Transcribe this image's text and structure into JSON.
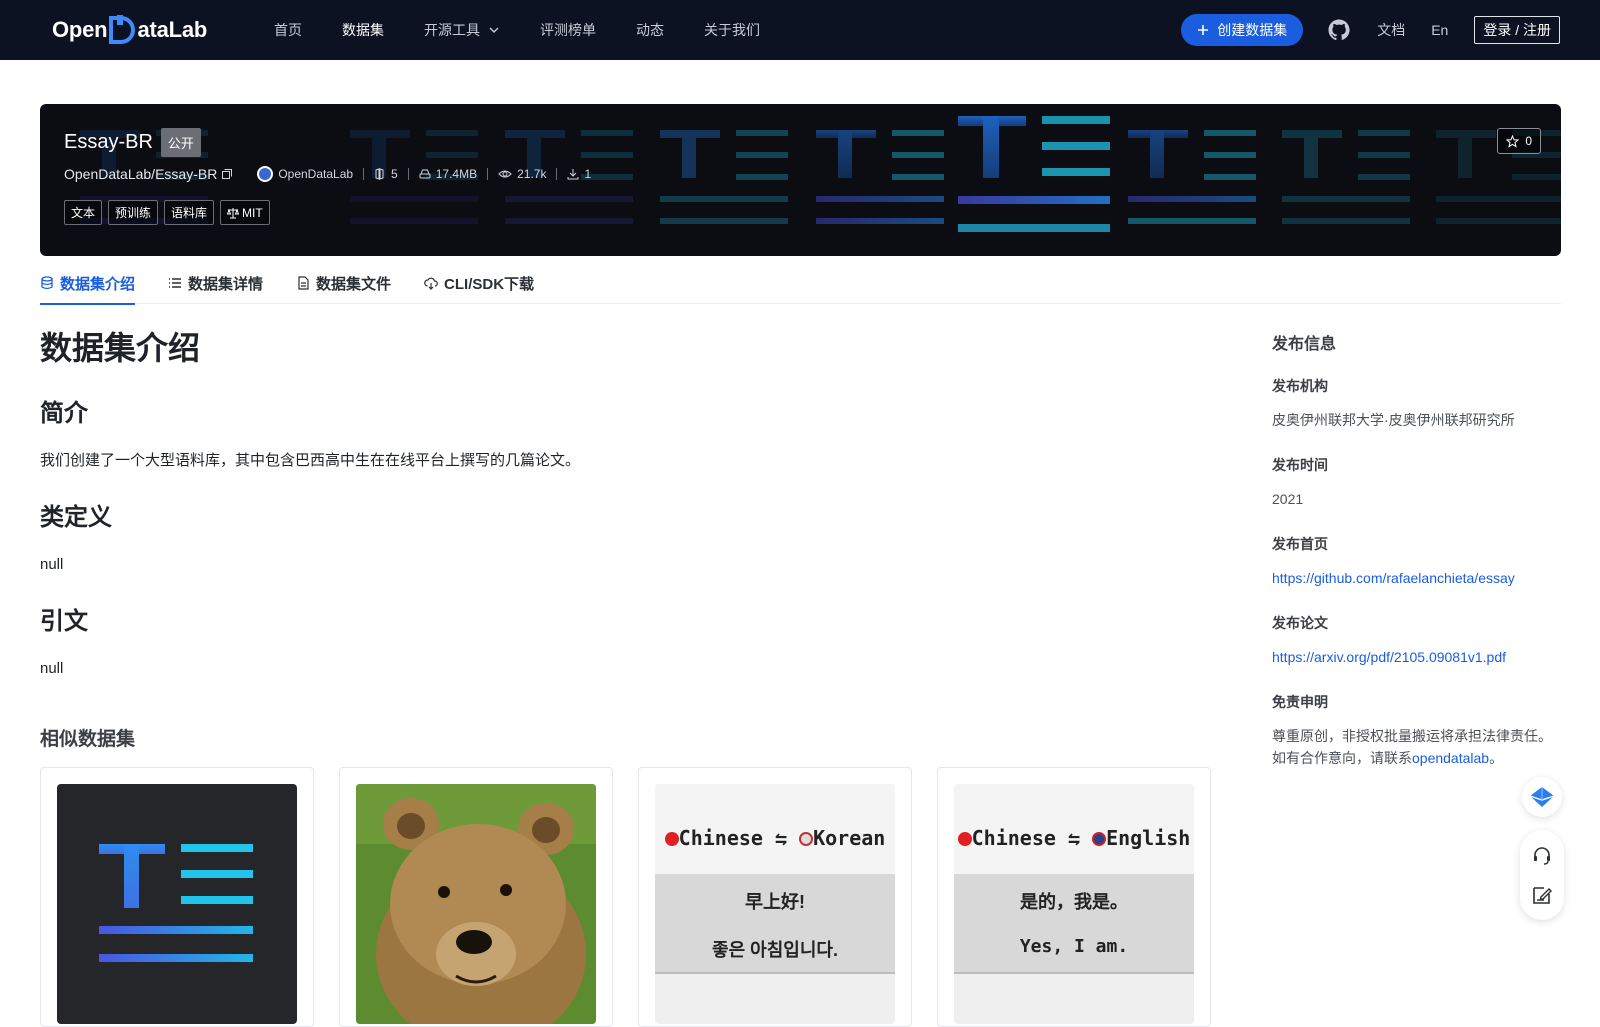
{
  "nav": {
    "logo_left": "Open",
    "logo_right": "ataLab",
    "items": [
      {
        "label": "首页"
      },
      {
        "label": "数据集"
      },
      {
        "label": "开源工具"
      },
      {
        "label": "评测榜单"
      },
      {
        "label": "动态"
      },
      {
        "label": "关于我们"
      }
    ],
    "create_label": "创建数据集",
    "docs_label": "文档",
    "lang_label": "En",
    "login_label": "登录 / 注册"
  },
  "banner": {
    "title": "Essay-BR",
    "visibility": "公开",
    "path": "OpenDataLab/Essay-BR",
    "org": "OpenDataLab",
    "files_count": "5",
    "size": "17.4MB",
    "views": "21.7k",
    "downloads": "1",
    "tags": [
      "文本",
      "预训练",
      "语料库"
    ],
    "license": "MIT",
    "stars": "0"
  },
  "tabs": [
    {
      "label": "数据集介绍",
      "icon": "database-icon"
    },
    {
      "label": "数据集详情",
      "icon": "list-icon"
    },
    {
      "label": "数据集文件",
      "icon": "file-icon"
    },
    {
      "label": "CLI/SDK下载",
      "icon": "cloud-download-icon"
    }
  ],
  "content": {
    "heading": "数据集介绍",
    "intro_heading": "简介",
    "intro_text": "我们创建了一个大型语料库，其中包含巴西高中生在在线平台上撰写的几篇论文。",
    "class_heading": "类定义",
    "class_text": "null",
    "cite_heading": "引文",
    "cite_text": "null"
  },
  "similar": {
    "title": "相似数据集",
    "cards": [
      {
        "thumb": "text-dataset-logo"
      },
      {
        "thumb": "bear-photo"
      },
      {
        "thumb": "translation-zh-ko",
        "line1": "Chinese ⇋ ",
        "lang2": "Korean",
        "zh": "早上好!",
        "other": "좋은 아침입니다."
      },
      {
        "thumb": "translation-zh-en",
        "line1": "Chinese ⇋ ",
        "lang2": "English",
        "zh": "是的，我是。",
        "other": "Yes, I am."
      }
    ]
  },
  "sidebar": {
    "title": "发布信息",
    "org_label": "发布机构",
    "org_value": "皮奥伊州联邦大学·皮奥伊州联邦研究所",
    "time_label": "发布时间",
    "time_value": "2021",
    "home_label": "发布首页",
    "home_value": "https://github.com/rafaelanchieta/essay",
    "paper_label": "发布论文",
    "paper_value": "https://arxiv.org/pdf/2105.09081v1.pdf",
    "disclaimer_label": "免责申明",
    "disclaimer_line1": "尊重原创，非授权批量搬运将承担法律责任。",
    "disclaimer_line2_prefix": "如有合作意向，请联系",
    "disclaimer_link": "opendatalab",
    "disclaimer_suffix": "。"
  },
  "colors": {
    "accent": "#1a5ddf",
    "nav_bg": "#0c1222",
    "banner_bg": "#0b0d13"
  }
}
